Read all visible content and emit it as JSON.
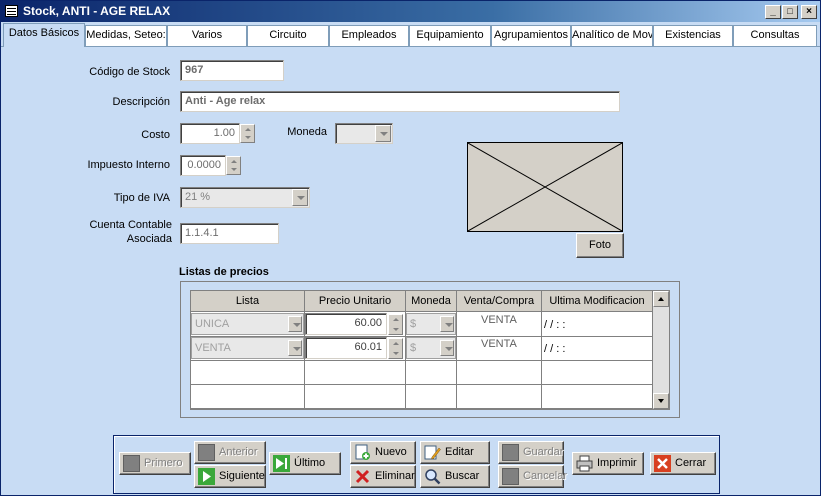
{
  "window": {
    "title": "Stock, ANTI - AGE RELAX",
    "minimize": "_",
    "maximize": "□",
    "close": "×"
  },
  "tabs": [
    {
      "label": "Datos Básicos",
      "active": true
    },
    {
      "label": "Medidas, Seteo:"
    },
    {
      "label": "Varios"
    },
    {
      "label": "Circuito"
    },
    {
      "label": "Empleados"
    },
    {
      "label": "Equipamiento"
    },
    {
      "label": "Agrupamientos"
    },
    {
      "label": "Analítico de Mov"
    },
    {
      "label": "Existencias"
    },
    {
      "label": "Consultas"
    }
  ],
  "form": {
    "codigo_label": "Código de Stock",
    "codigo_value": "967",
    "descripcion_label": "Descripción",
    "descripcion_value": "Anti - Age relax",
    "costo_label": "Costo",
    "costo_value": "1.00",
    "moneda_label": "Moneda",
    "moneda_value": "",
    "impuesto_label": "Impuesto Interno",
    "impuesto_value": "0.0000",
    "tipo_iva_label": "Tipo de IVA",
    "tipo_iva_value": "21 %",
    "cuenta_label_1": "Cuenta Contable",
    "cuenta_label_2": "Asociada",
    "cuenta_value": "1.1.4.1",
    "foto_button": "Foto"
  },
  "price_lists": {
    "title": "Listas de precios",
    "headers": [
      "Lista",
      "Precio Unitario",
      "Moneda",
      "Venta/Compra",
      "Ultima Modificacion"
    ],
    "rows": [
      {
        "lista": "UNICA",
        "precio": "60.00",
        "moneda": "$",
        "venta_compra": "VENTA",
        "ultima": "/ /      : :"
      },
      {
        "lista": "VENTA",
        "precio": "60.01",
        "moneda": "$",
        "venta_compra": "VENTA",
        "ultima": "/ /      : :"
      }
    ]
  },
  "toolbar": {
    "primero": "Primero",
    "anterior": "Anterior",
    "siguiente": "Siguiente",
    "ultimo": "Último",
    "nuevo": "Nuevo",
    "editar": "Editar",
    "eliminar": "Eliminar",
    "buscar": "Buscar",
    "guardar": "Guardar",
    "cancelar": "Cancelar",
    "imprimir": "Imprimir",
    "cerrar": "Cerrar"
  },
  "colors": {
    "background": "#c8dcf4",
    "titlebar": "#0a246a",
    "disabled_text": "#808080"
  }
}
